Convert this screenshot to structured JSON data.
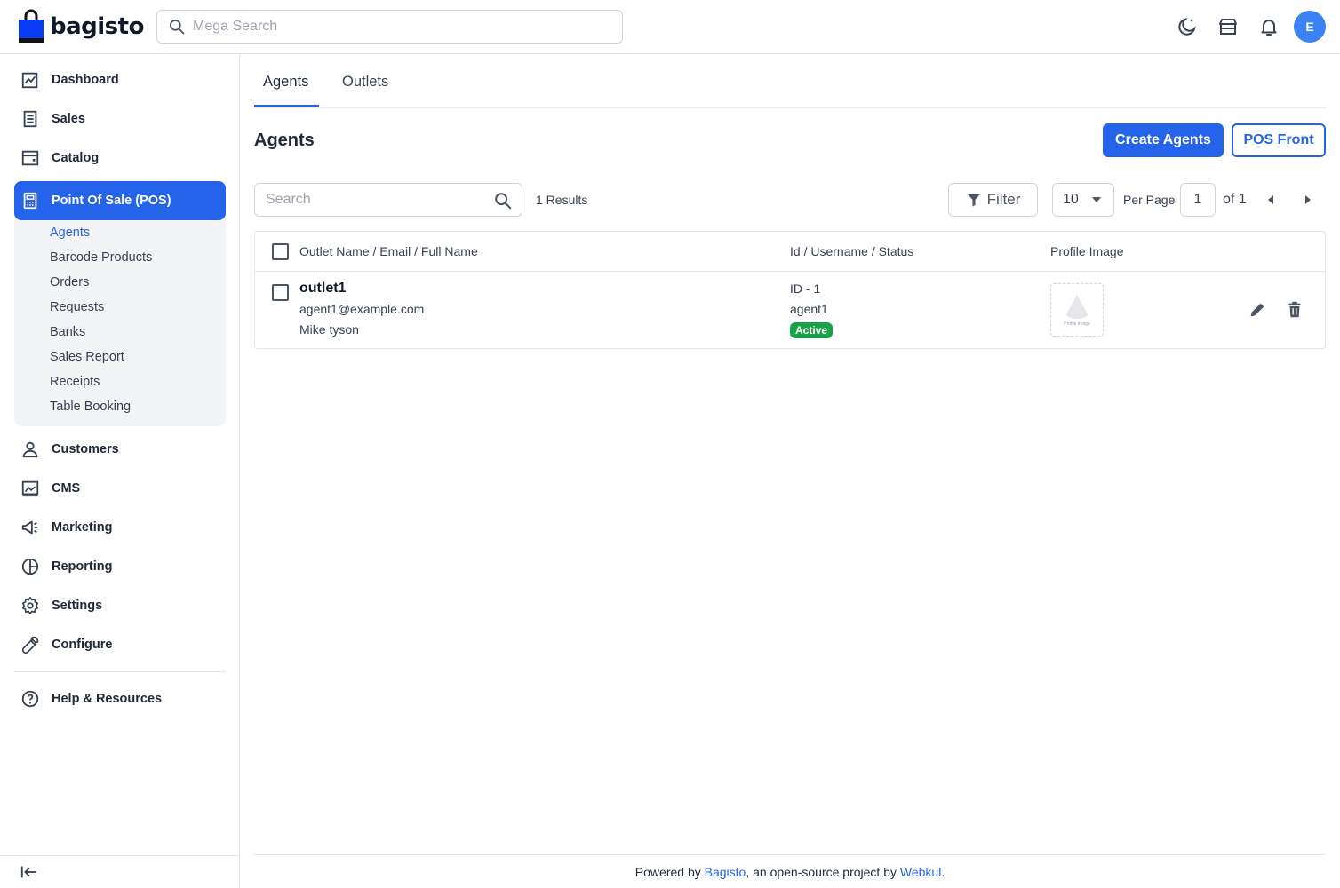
{
  "brand": {
    "name": "bagisto"
  },
  "header": {
    "search_placeholder": "Mega Search",
    "avatar_initial": "E",
    "icons": [
      "moon-icon",
      "store-icon",
      "bell-icon"
    ]
  },
  "sidebar": {
    "items": [
      {
        "label": "Dashboard",
        "icon": "dashboard-icon"
      },
      {
        "label": "Sales",
        "icon": "sales-icon"
      },
      {
        "label": "Catalog",
        "icon": "catalog-icon"
      },
      {
        "label": "Point Of Sale (POS)",
        "icon": "pos-icon",
        "active": true
      },
      {
        "label": "Customers",
        "icon": "customer-icon"
      },
      {
        "label": "CMS",
        "icon": "cms-icon"
      },
      {
        "label": "Marketing",
        "icon": "megaphone-icon"
      },
      {
        "label": "Reporting",
        "icon": "pie-chart-icon"
      },
      {
        "label": "Settings",
        "icon": "gear-icon"
      },
      {
        "label": "Configure",
        "icon": "wrench-icon"
      }
    ],
    "pos_sub_items": [
      {
        "label": "Agents",
        "active": true
      },
      {
        "label": "Barcode Products"
      },
      {
        "label": "Orders"
      },
      {
        "label": "Requests"
      },
      {
        "label": "Banks"
      },
      {
        "label": "Sales Report"
      },
      {
        "label": "Receipts"
      },
      {
        "label": "Table Booking"
      }
    ],
    "help_label": "Help & Resources"
  },
  "tabs": [
    {
      "label": "Agents",
      "active": true
    },
    {
      "label": "Outlets"
    }
  ],
  "page": {
    "title": "Agents",
    "create_button": "Create Agents",
    "pos_front_button": "POS Front"
  },
  "toolbar": {
    "search_placeholder": "Search",
    "results": "1 Results",
    "filter_label": "Filter",
    "per_page_value": "10",
    "per_page_label": "Per Page",
    "current_page": "1",
    "of_label": "of 1"
  },
  "table": {
    "columns": [
      "Outlet Name / Email / Full Name",
      "Id / Username / Status",
      "Profile Image"
    ],
    "rows": [
      {
        "outlet": "outlet1",
        "email": "agent1@example.com",
        "full_name": "Mike tyson",
        "id": "ID - 1",
        "username": "agent1",
        "status": "Active",
        "profile_caption": "Profile Image"
      }
    ]
  },
  "footer": {
    "prefix": "Powered by ",
    "link1": "Bagisto",
    "middle": ", an open-source project by ",
    "link2": "Webkul",
    "suffix": "."
  },
  "colors": {
    "primary": "#2563eb",
    "success": "#16a34a",
    "avatar": "#3b82f6"
  }
}
